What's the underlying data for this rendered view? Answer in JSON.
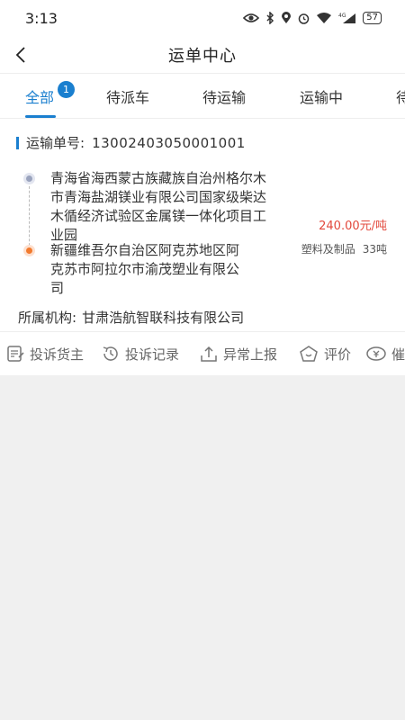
{
  "status_bar": {
    "time": "3:13",
    "battery": "57",
    "network": "4G",
    "icons": [
      "eye-icon",
      "bluetooth-icon",
      "location-icon",
      "alarm-icon",
      "wifi-icon",
      "signal-icon",
      "battery-icon"
    ]
  },
  "nav": {
    "title": "运单中心",
    "back_icon": "chevron-left-icon"
  },
  "tabs": [
    {
      "label": "全部",
      "active": true,
      "badge": "1"
    },
    {
      "label": "待派车",
      "active": false
    },
    {
      "label": "待运输",
      "active": false
    },
    {
      "label": "运输中",
      "active": false
    },
    {
      "label": "待",
      "active": false
    }
  ],
  "order": {
    "number_label": "运输单号:",
    "number_value": "13002403050001001",
    "from_address": "青海省海西蒙古族藏族自治州格尔木市青海盐湖镁业有限公司国家级柴达木循经济试验区金属镁一体化项目工业园",
    "to_address": "新疆维吾尔自治区阿克苏地区阿克苏市阿拉尔市渝茂塑业有限公司",
    "price": "240.00元/吨",
    "cargo_type": "塑料及制品",
    "cargo_weight": "33吨",
    "org_label": "所属机构:",
    "org_value": "甘肃浩航智联科技有限公司"
  },
  "actions": [
    {
      "label": "投诉货主",
      "icon": "complaint-icon"
    },
    {
      "label": "投诉记录",
      "icon": "history-icon"
    },
    {
      "label": "异常上报",
      "icon": "upload-icon"
    },
    {
      "label": "评价",
      "icon": "rating-icon"
    },
    {
      "label": "催",
      "icon": "money-icon"
    }
  ],
  "colors": {
    "accent": "#1a7fcf",
    "price": "#e2483c",
    "destination_dot": "#f27a2e",
    "origin_dot": "#9aa3bd",
    "background": "#f0f0f0"
  }
}
